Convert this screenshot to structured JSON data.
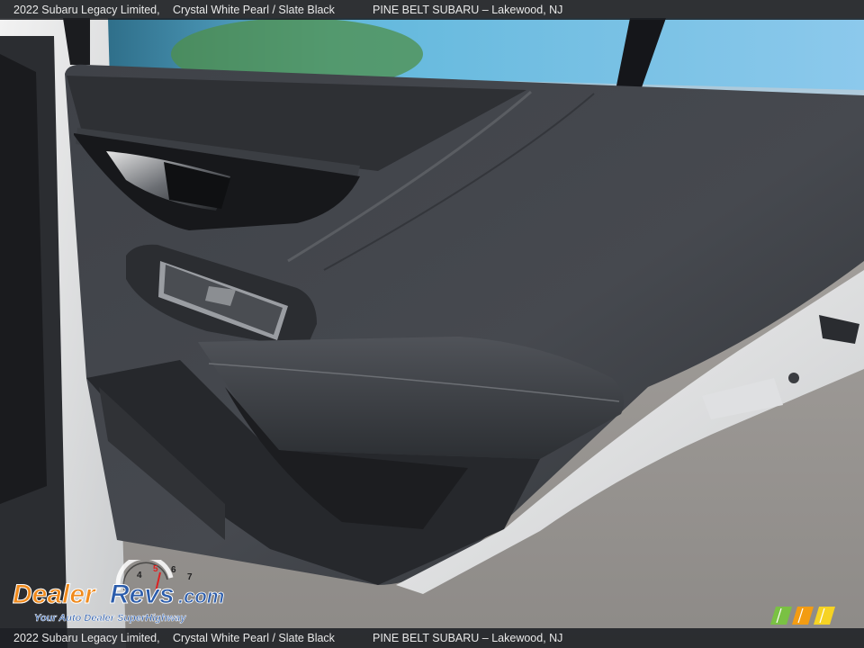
{
  "caption": {
    "model": "2022 Subaru Legacy Limited,",
    "color": "Crystal White Pearl / Slate Black",
    "dealer": "PINE BELT SUBARU – Lakewood, NJ"
  },
  "photo": {
    "subject": "rear-door-interior-panel"
  },
  "watermark": {
    "brand": "DealerRevs.com",
    "tagline": "Your Auto Dealer SuperHighway",
    "gauge_digits": [
      "4",
      "5",
      "6",
      "7"
    ]
  },
  "colors": {
    "panel": "#3a3d42",
    "caption_bg": "#1e2024",
    "sky": "#6fb4e2",
    "logo_orange": "#f08a1c",
    "logo_blue": "#2b5cab",
    "badge_green": "#7ac143"
  }
}
